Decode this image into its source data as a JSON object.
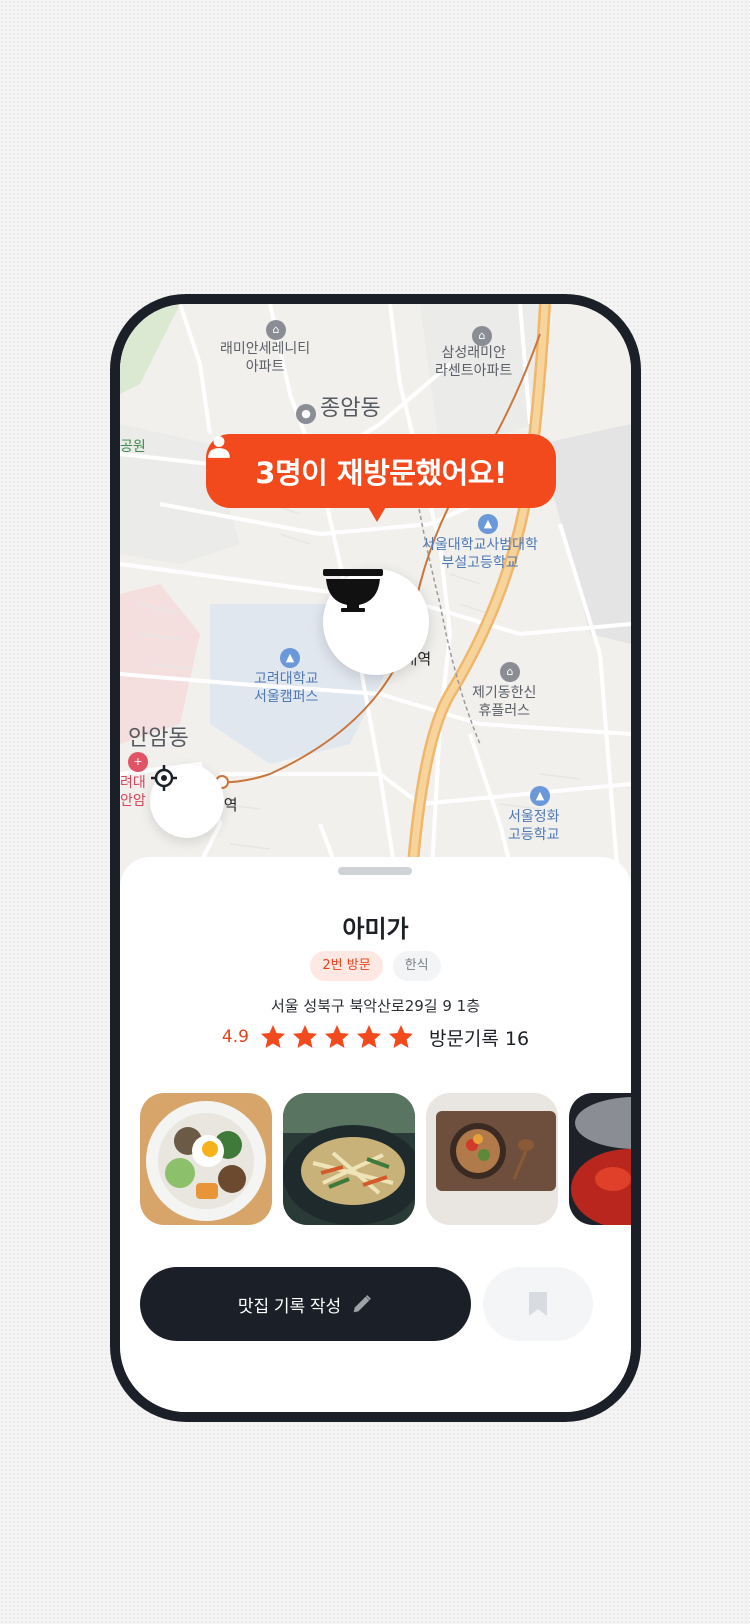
{
  "map": {
    "labels": {
      "remian_serenity": "래미안세레니티\n아파트",
      "samsung_remian": "삼성래미안\n라센트아파트",
      "jongam": "종암동",
      "park": "공원",
      "sabeom": "서울대학교사범대학\n부설고등학교",
      "korea_univ_station": "고려대역",
      "korea_univ": "고려대학교\n서울캠퍼스",
      "jegi_hansin": "제기동한신\n휴플러스",
      "anam": "안암동",
      "anam_hospital": "려대\n안암",
      "anam_station": "암역",
      "jeonghwa": "서울정화\n고등학교"
    }
  },
  "bubble": {
    "text": "3명이 재방문했어요!"
  },
  "place": {
    "name": "아미가",
    "visit_chip": "2번 방문",
    "category_chip": "한식",
    "address": "서울 성북구 북악산로29길 9 1층",
    "rating": "4.9",
    "rating_value": 4.9,
    "visit_label": "방문기록",
    "visit_count": "16"
  },
  "actions": {
    "write_label": "맛집 기록 작성"
  },
  "colors": {
    "accent": "#f24a1c",
    "dark": "#1b1f27",
    "star": "#f24a1c"
  }
}
